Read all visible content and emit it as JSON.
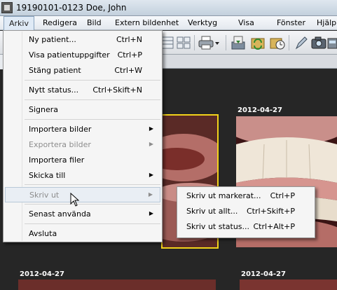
{
  "window": {
    "title": "19190101-0123 Doe, John"
  },
  "menubar": [
    {
      "label": "Arkiv",
      "active": true
    },
    {
      "label": "Redigera"
    },
    {
      "label": "Bild"
    },
    {
      "label": "Extern bildenhet"
    },
    {
      "label": "Verktyg"
    },
    {
      "label": "Visa"
    },
    {
      "label": "Fönster"
    },
    {
      "label": "Hjälp"
    }
  ],
  "arkiv_menu": {
    "items": [
      {
        "label": "Ny patient...",
        "shortcut": "Ctrl+N"
      },
      {
        "label": "Visa patientuppgifter",
        "shortcut": "Ctrl+P"
      },
      {
        "label": "Stäng patient",
        "shortcut": "Ctrl+W"
      },
      {
        "label": "Nytt status...",
        "shortcut": "Ctrl+Skift+N"
      },
      {
        "label": "Signera",
        "shortcut": ""
      },
      {
        "label": "Importera bilder",
        "shortcut": "",
        "submenu": true
      },
      {
        "label": "Exportera bilder",
        "shortcut": "",
        "submenu": true,
        "disabled": true
      },
      {
        "label": "Importera filer",
        "shortcut": ""
      },
      {
        "label": "Skicka till",
        "shortcut": "",
        "submenu": true
      },
      {
        "label": "Skriv ut",
        "shortcut": "",
        "submenu": true,
        "disabled": true,
        "highlighted": true
      },
      {
        "label": "Senast använda",
        "shortcut": "",
        "submenu": true
      },
      {
        "label": "Avsluta",
        "shortcut": ""
      }
    ]
  },
  "skriv_ut_submenu": {
    "items": [
      {
        "label": "Skriv ut markerat...",
        "shortcut": "Ctrl+P"
      },
      {
        "label": "Skriv ut allt...",
        "shortcut": "Ctrl+Skift+P"
      },
      {
        "label": "Skriv ut status...",
        "shortcut": "Ctrl+Alt+P"
      }
    ]
  },
  "gallery": {
    "dates": [
      "2012-04-27",
      "2012-04-27",
      "2012-04-27"
    ],
    "selected_color": "#f2d21b"
  },
  "toolbar_icons": [
    "layout-icon",
    "grid-icon",
    "print-icon",
    "dropdown-arrow-icon",
    "download-icon",
    "sync-icon",
    "history-icon",
    "pen-icon",
    "camera-icon",
    "scanner-icon"
  ]
}
